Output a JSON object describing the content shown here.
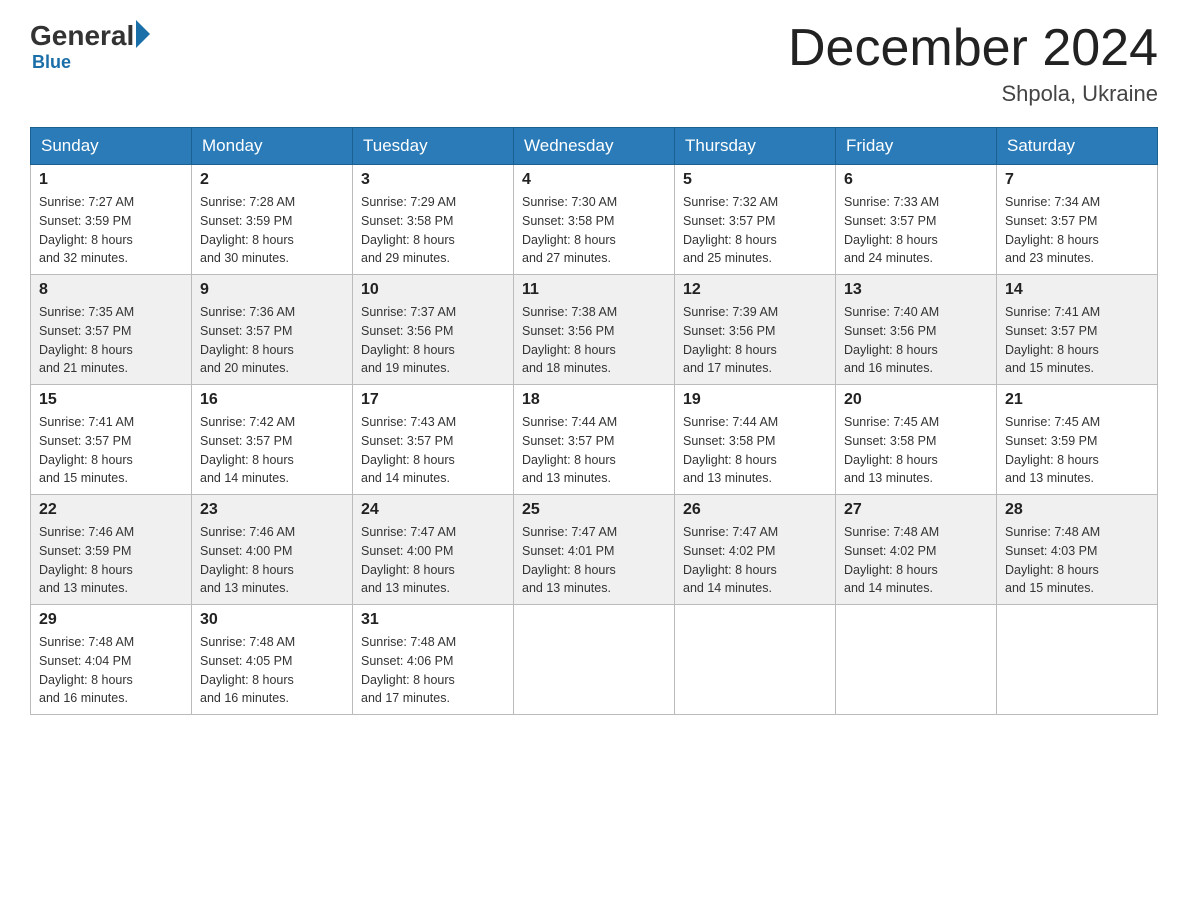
{
  "logo": {
    "general": "General",
    "blue": "Blue"
  },
  "header": {
    "month": "December 2024",
    "location": "Shpola, Ukraine"
  },
  "days_of_week": [
    "Sunday",
    "Monday",
    "Tuesday",
    "Wednesday",
    "Thursday",
    "Friday",
    "Saturday"
  ],
  "weeks": [
    [
      {
        "day": "1",
        "sunrise": "7:27 AM",
        "sunset": "3:59 PM",
        "daylight": "8 hours and 32 minutes."
      },
      {
        "day": "2",
        "sunrise": "7:28 AM",
        "sunset": "3:59 PM",
        "daylight": "8 hours and 30 minutes."
      },
      {
        "day": "3",
        "sunrise": "7:29 AM",
        "sunset": "3:58 PM",
        "daylight": "8 hours and 29 minutes."
      },
      {
        "day": "4",
        "sunrise": "7:30 AM",
        "sunset": "3:58 PM",
        "daylight": "8 hours and 27 minutes."
      },
      {
        "day": "5",
        "sunrise": "7:32 AM",
        "sunset": "3:57 PM",
        "daylight": "8 hours and 25 minutes."
      },
      {
        "day": "6",
        "sunrise": "7:33 AM",
        "sunset": "3:57 PM",
        "daylight": "8 hours and 24 minutes."
      },
      {
        "day": "7",
        "sunrise": "7:34 AM",
        "sunset": "3:57 PM",
        "daylight": "8 hours and 23 minutes."
      }
    ],
    [
      {
        "day": "8",
        "sunrise": "7:35 AM",
        "sunset": "3:57 PM",
        "daylight": "8 hours and 21 minutes."
      },
      {
        "day": "9",
        "sunrise": "7:36 AM",
        "sunset": "3:57 PM",
        "daylight": "8 hours and 20 minutes."
      },
      {
        "day": "10",
        "sunrise": "7:37 AM",
        "sunset": "3:56 PM",
        "daylight": "8 hours and 19 minutes."
      },
      {
        "day": "11",
        "sunrise": "7:38 AM",
        "sunset": "3:56 PM",
        "daylight": "8 hours and 18 minutes."
      },
      {
        "day": "12",
        "sunrise": "7:39 AM",
        "sunset": "3:56 PM",
        "daylight": "8 hours and 17 minutes."
      },
      {
        "day": "13",
        "sunrise": "7:40 AM",
        "sunset": "3:56 PM",
        "daylight": "8 hours and 16 minutes."
      },
      {
        "day": "14",
        "sunrise": "7:41 AM",
        "sunset": "3:57 PM",
        "daylight": "8 hours and 15 minutes."
      }
    ],
    [
      {
        "day": "15",
        "sunrise": "7:41 AM",
        "sunset": "3:57 PM",
        "daylight": "8 hours and 15 minutes."
      },
      {
        "day": "16",
        "sunrise": "7:42 AM",
        "sunset": "3:57 PM",
        "daylight": "8 hours and 14 minutes."
      },
      {
        "day": "17",
        "sunrise": "7:43 AM",
        "sunset": "3:57 PM",
        "daylight": "8 hours and 14 minutes."
      },
      {
        "day": "18",
        "sunrise": "7:44 AM",
        "sunset": "3:57 PM",
        "daylight": "8 hours and 13 minutes."
      },
      {
        "day": "19",
        "sunrise": "7:44 AM",
        "sunset": "3:58 PM",
        "daylight": "8 hours and 13 minutes."
      },
      {
        "day": "20",
        "sunrise": "7:45 AM",
        "sunset": "3:58 PM",
        "daylight": "8 hours and 13 minutes."
      },
      {
        "day": "21",
        "sunrise": "7:45 AM",
        "sunset": "3:59 PM",
        "daylight": "8 hours and 13 minutes."
      }
    ],
    [
      {
        "day": "22",
        "sunrise": "7:46 AM",
        "sunset": "3:59 PM",
        "daylight": "8 hours and 13 minutes."
      },
      {
        "day": "23",
        "sunrise": "7:46 AM",
        "sunset": "4:00 PM",
        "daylight": "8 hours and 13 minutes."
      },
      {
        "day": "24",
        "sunrise": "7:47 AM",
        "sunset": "4:00 PM",
        "daylight": "8 hours and 13 minutes."
      },
      {
        "day": "25",
        "sunrise": "7:47 AM",
        "sunset": "4:01 PM",
        "daylight": "8 hours and 13 minutes."
      },
      {
        "day": "26",
        "sunrise": "7:47 AM",
        "sunset": "4:02 PM",
        "daylight": "8 hours and 14 minutes."
      },
      {
        "day": "27",
        "sunrise": "7:48 AM",
        "sunset": "4:02 PM",
        "daylight": "8 hours and 14 minutes."
      },
      {
        "day": "28",
        "sunrise": "7:48 AM",
        "sunset": "4:03 PM",
        "daylight": "8 hours and 15 minutes."
      }
    ],
    [
      {
        "day": "29",
        "sunrise": "7:48 AM",
        "sunset": "4:04 PM",
        "daylight": "8 hours and 16 minutes."
      },
      {
        "day": "30",
        "sunrise": "7:48 AM",
        "sunset": "4:05 PM",
        "daylight": "8 hours and 16 minutes."
      },
      {
        "day": "31",
        "sunrise": "7:48 AM",
        "sunset": "4:06 PM",
        "daylight": "8 hours and 17 minutes."
      },
      null,
      null,
      null,
      null
    ]
  ],
  "labels": {
    "sunrise": "Sunrise:",
    "sunset": "Sunset:",
    "daylight": "Daylight:"
  },
  "colors": {
    "header_bg": "#2a7bb8",
    "accent": "#1a6fa8"
  }
}
